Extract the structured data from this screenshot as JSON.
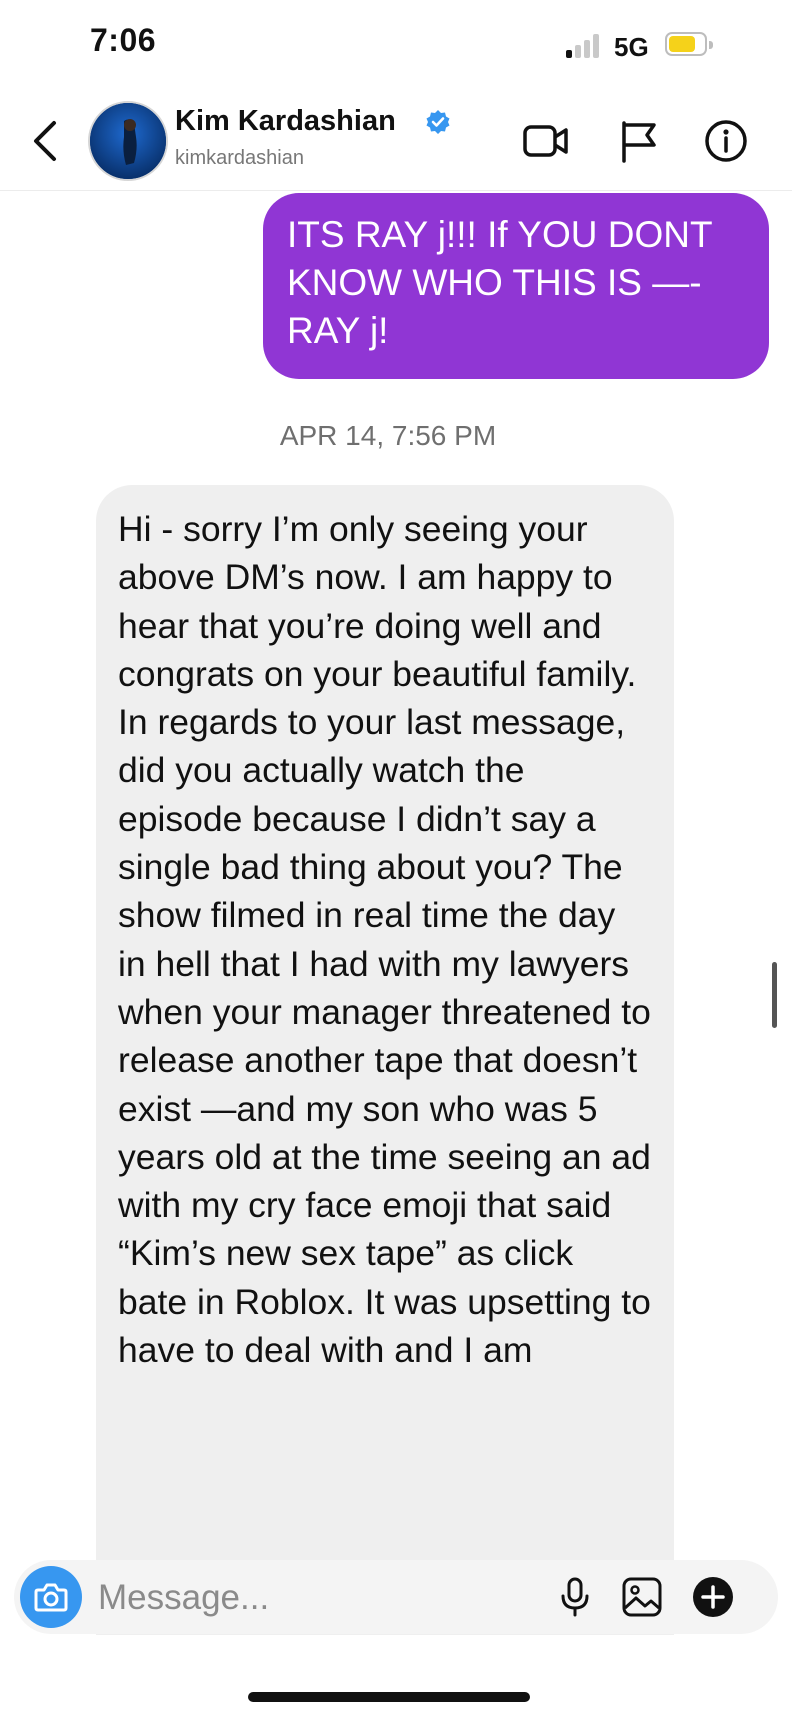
{
  "status_bar": {
    "time": "7:06",
    "network": "5G",
    "battery_level": 0.65,
    "battery_color": "#f5d21a",
    "signal_bars_active": 1
  },
  "header": {
    "back_icon": "chevron-left-icon",
    "contact_name": "Kim Kardashian",
    "contact_handle": "kimkardashian",
    "verified_icon": "verified-badge-icon",
    "verified_color": "#3797f0",
    "actions": [
      "video-call-icon",
      "flag-icon",
      "info-icon"
    ]
  },
  "messages": {
    "outgoing": {
      "text": "ITS RAY j!!! If YOU DONT KNOW WHO THIS IS —- RAY j!",
      "color": "#9036d4"
    },
    "timestamp": "APR 14, 7:56 PM",
    "incoming": {
      "text": "Hi - sorry I’m only seeing your above DM’s now. I am happy to hear that you’re doing well and congrats on your beautiful family. In regards to your last message, did you actually watch the episode because I didn’t say a single bad thing about you? The show filmed in real time the day in hell that I had with my lawyers when your manager threatened to release another tape that doesn’t exist —and my son who was 5 years old at the time seeing an ad with my cry face emoji that said “Kim’s new sex tape” as click bate in Roblox. It was upsetting to have to deal with and I am",
      "color": "#efefef"
    }
  },
  "composer": {
    "placeholder": "Message...",
    "camera_icon": "camera-icon",
    "camera_color": "#3797f0",
    "icons": [
      "microphone-icon",
      "gallery-icon",
      "plus-icon"
    ]
  }
}
